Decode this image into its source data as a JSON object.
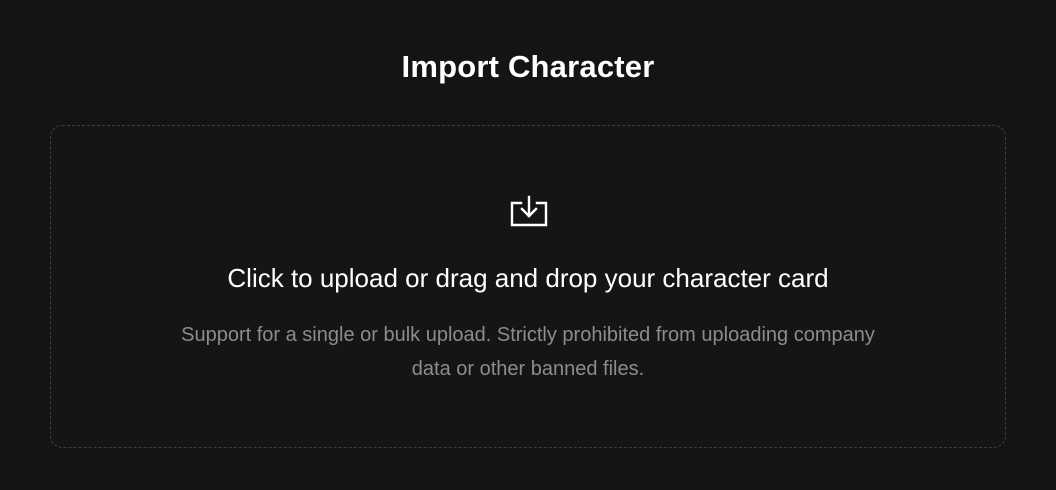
{
  "header": {
    "title": "Import Character"
  },
  "upload": {
    "icon": "download-tray-icon",
    "headline": "Click to upload or drag and drop your character card",
    "hint": "Support for a single or bulk upload. Strictly prohibited from uploading company data or other banned files."
  },
  "colors": {
    "background": "#141414",
    "title_text": "#ffffff",
    "hint_text": "#8c8c8c",
    "dropzone_border": "#3d3d3d"
  }
}
